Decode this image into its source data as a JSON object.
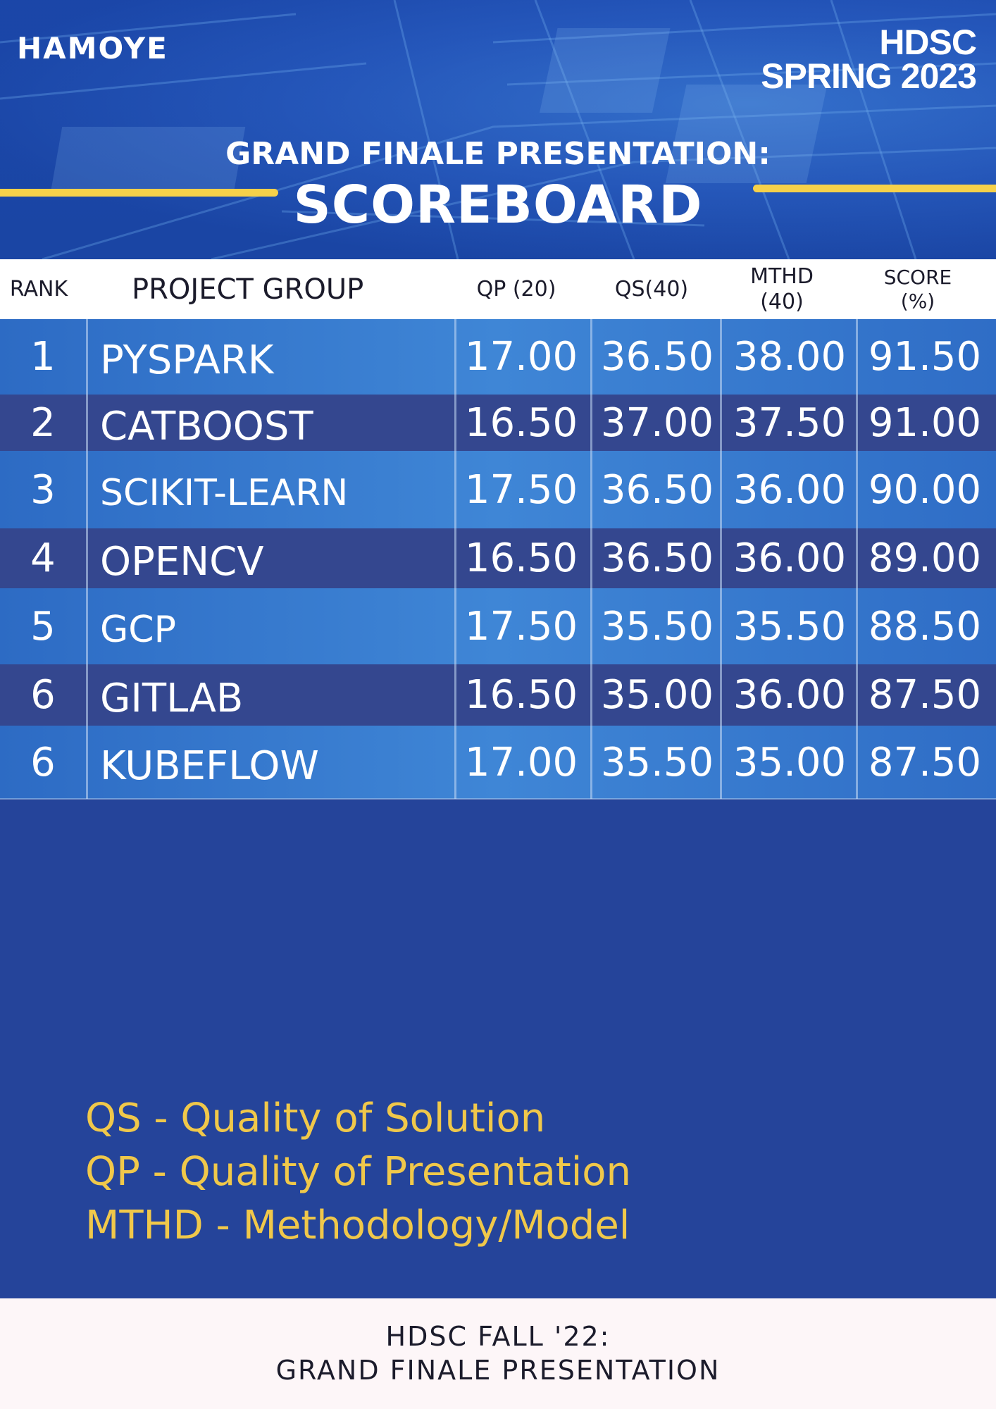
{
  "brand": {
    "logo_text": "HAMOYE"
  },
  "edition": {
    "line1": "HDSC",
    "line2": "SPRING 2023"
  },
  "title": {
    "subtitle": "GRAND FINALE PRESENTATION:",
    "main": "SCOREBOARD"
  },
  "colors": {
    "accent": "#f6d14a",
    "page_bg": "#25449a",
    "row_dark": "#34478f",
    "row_light": "#3f86d6",
    "legend_text": "#f0c84a"
  },
  "table": {
    "headers": {
      "rank": "RANK",
      "group": "PROJECT GROUP",
      "qp": "QP (20)",
      "qs": "QS(40)",
      "mthd": "MTHD\n(40)",
      "score": "SCORE\n(%)"
    },
    "rows": [
      {
        "rank": "1",
        "group": "PYSPARK",
        "qp": "17.00",
        "qs": "36.50",
        "mthd": "38.00",
        "score": "91.50"
      },
      {
        "rank": "2",
        "group": "CATBOOST",
        "qp": "16.50",
        "qs": "37.00",
        "mthd": "37.50",
        "score": "91.00"
      },
      {
        "rank": "3",
        "group": "SCIKIT-LEARN",
        "qp": "17.50",
        "qs": "36.50",
        "mthd": "36.00",
        "score": "90.00"
      },
      {
        "rank": "4",
        "group": "OPENCV",
        "qp": "16.50",
        "qs": "36.50",
        "mthd": "36.00",
        "score": "89.00"
      },
      {
        "rank": "5",
        "group": "GCP",
        "qp": "17.50",
        "qs": "35.50",
        "mthd": "35.50",
        "score": "88.50"
      },
      {
        "rank": "6",
        "group": "GITLAB",
        "qp": "16.50",
        "qs": "35.00",
        "mthd": "36.00",
        "score": "87.50"
      },
      {
        "rank": "6",
        "group": "KUBEFLOW",
        "qp": "17.00",
        "qs": "35.50",
        "mthd": "35.00",
        "score": "87.50"
      }
    ]
  },
  "legend": [
    "QS - Quality of Solution",
    "QP - Quality of Presentation",
    "MTHD - Methodology/Model"
  ],
  "footer": {
    "line1": "HDSC FALL '22:",
    "line2": "GRAND FINALE PRESENTATION"
  }
}
